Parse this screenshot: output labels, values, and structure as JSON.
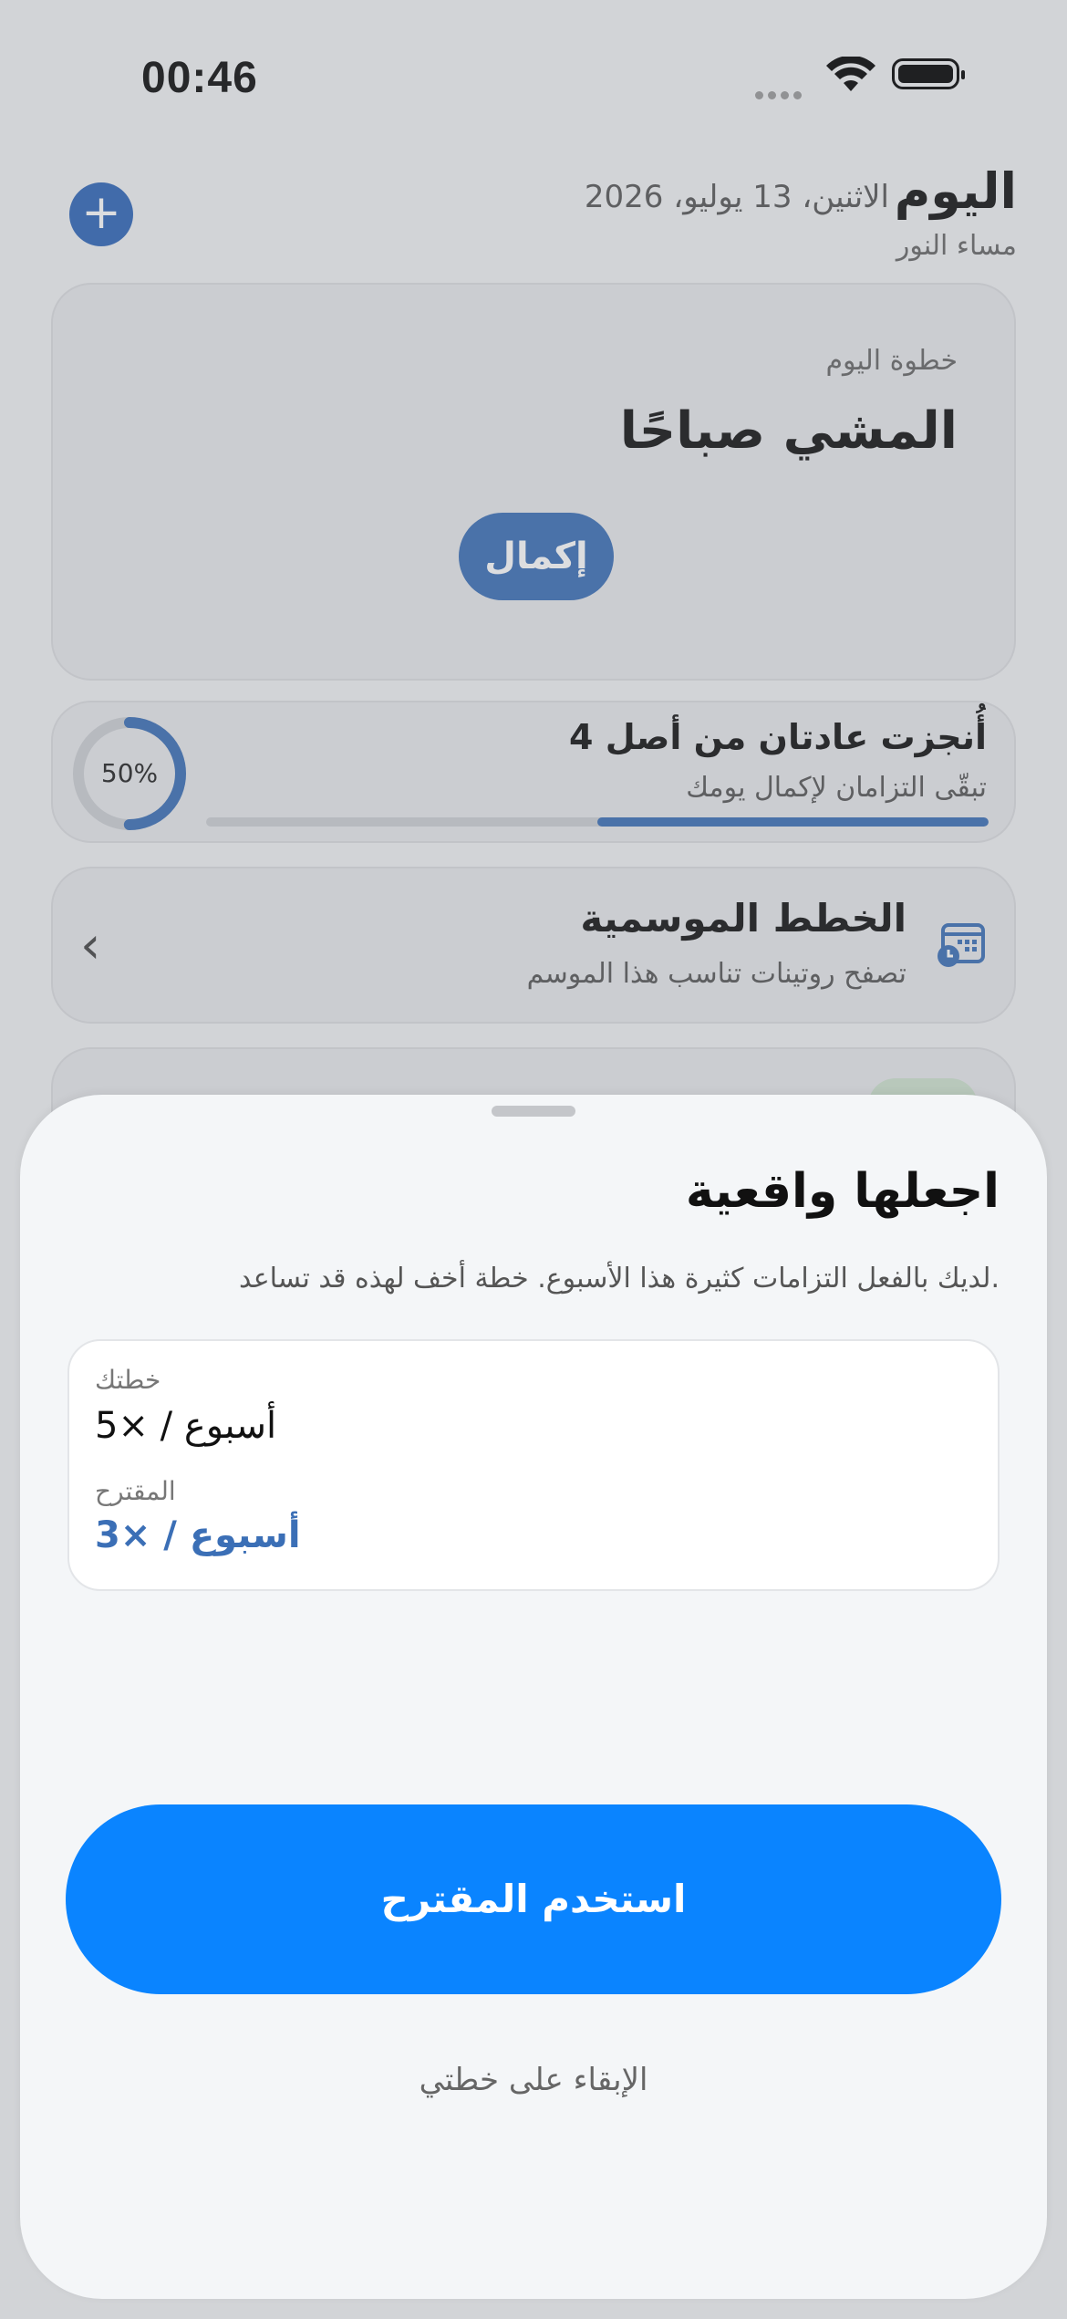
{
  "status_bar": {
    "time": "00:46"
  },
  "header": {
    "title": "اليوم",
    "date": "الاثنين، 13 يوليو، 2026",
    "greeting": "مساء النور",
    "add_symbol": "+"
  },
  "step_card": {
    "label": "خطوة اليوم",
    "title": "المشي صباحًا",
    "complete_label": "إكمال"
  },
  "progress_card": {
    "percent_label": "50%",
    "progress": 0.5,
    "title": "أُنجزت عادتان من أصل 4",
    "subtitle": "تبقّى التزامان لإكمال يومك"
  },
  "seasonal_card": {
    "title": "الخطط الموسمية",
    "subtitle": "تصفح روتينات تناسب هذا الموسم",
    "icon": "calendar-clock-icon"
  },
  "sheet": {
    "title": "اجعلها واقعية",
    "description": "لديك بالفعل التزامات كثيرة هذا الأسبوع. خطة أخف لهذه قد تساعد.",
    "your_plan_label": "خطتك",
    "your_plan_value": "5× / أسبوع",
    "suggested_label": "المقترح",
    "suggested_value": "3× / أسبوع",
    "use_suggested_label": "استخدم المقترح",
    "keep_plan_label": "الإبقاء على خطتي"
  },
  "colors": {
    "accent": "#3b6fb6",
    "primary_button": "#0a84ff"
  }
}
